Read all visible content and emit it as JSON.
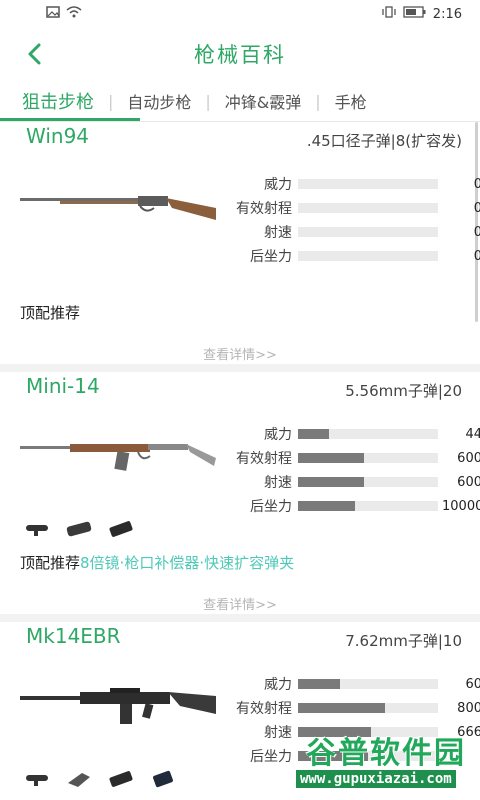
{
  "status": {
    "time": "2:16"
  },
  "header": {
    "title": "枪械百科"
  },
  "tabs": [
    {
      "label": "狙击步枪",
      "active": true
    },
    {
      "label": "自动步枪",
      "active": false
    },
    {
      "label": "冲锋&霰弹",
      "active": false
    },
    {
      "label": "手枪",
      "active": false
    }
  ],
  "colors": {
    "accent": "#2fa866",
    "link": "#4ec9b8",
    "bar_fill": "#7a7a7a",
    "bar_track": "#eaeaea"
  },
  "guns": [
    {
      "name": "Win94",
      "ammo": ".45口径子弹|8(扩容发)",
      "stats": [
        {
          "label": "威力",
          "value": "0",
          "fraction": 0
        },
        {
          "label": "有效射程",
          "value": "0",
          "fraction": 0
        },
        {
          "label": "射速",
          "value": "0",
          "fraction": 0
        },
        {
          "label": "后坐力",
          "value": "0",
          "fraction": 0
        }
      ],
      "recommend_label": "顶配推荐",
      "recommend_items": "",
      "more": "查看详情>>"
    },
    {
      "name": "Mini-14",
      "ammo": "5.56mm子弹|20",
      "stats": [
        {
          "label": "威力",
          "value": "44",
          "fraction": 0.22
        },
        {
          "label": "有效射程",
          "value": "600",
          "fraction": 0.47
        },
        {
          "label": "射速",
          "value": "600",
          "fraction": 0.47
        },
        {
          "label": "后坐力",
          "value": "10000",
          "fraction": 0.41
        }
      ],
      "accessories": [
        "scope-icon",
        "muzzle-icon",
        "magazine-icon"
      ],
      "recommend_label": "顶配推荐",
      "recommend_items": "8倍镜·枪口补偿器·快速扩容弹夹",
      "more": "查看详情>>"
    },
    {
      "name": "Mk14EBR",
      "ammo": "7.62mm子弹|10",
      "stats": [
        {
          "label": "威力",
          "value": "60",
          "fraction": 0.3
        },
        {
          "label": "有效射程",
          "value": "800",
          "fraction": 0.62
        },
        {
          "label": "射速",
          "value": "666",
          "fraction": 0.52
        },
        {
          "label": "后坐力",
          "value": "",
          "fraction": 0.5
        }
      ],
      "accessories": [
        "scope-icon",
        "stock-icon",
        "magazine-icon",
        "magazine-icon"
      ]
    }
  ],
  "watermark": {
    "brand": "谷普软件园",
    "url": "www.gupuxiazai.com"
  }
}
